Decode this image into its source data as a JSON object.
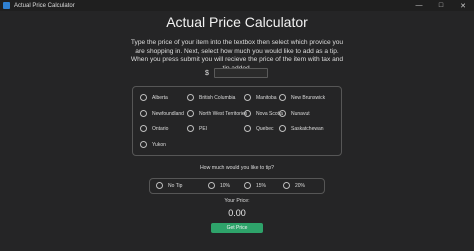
{
  "window": {
    "title": "Actual Price Calculator",
    "controls": [
      "—",
      "□",
      "✕"
    ]
  },
  "heading": "Actual Price Calculator",
  "instructions": "Type the price of your item into the textbox then select which provice you are shopping in. Next, select how much you would like to add as a tip. When you press submit you will recieve the price of the item with tax and tip added.",
  "price_input": {
    "currency_symbol": "$",
    "value": ""
  },
  "provinces": [
    "Alberta",
    "British Columbia",
    "Manitoba",
    "New Brunswick",
    "Newfoundland",
    "North West Territories",
    "Nova Scotia",
    "Nunavut",
    "Ontario",
    "PEI",
    "Quebec",
    "Saskatchewan",
    "Yukon"
  ],
  "tip": {
    "question": "How much would you like to tip?",
    "options": [
      "No Tip",
      "10%",
      "15%",
      "20%"
    ]
  },
  "result": {
    "label": "Your Price:",
    "value": "0.00"
  },
  "submit_label": "Get Price",
  "colors": {
    "background": "#252526",
    "button": "#2ea36a",
    "border": "#565656"
  }
}
